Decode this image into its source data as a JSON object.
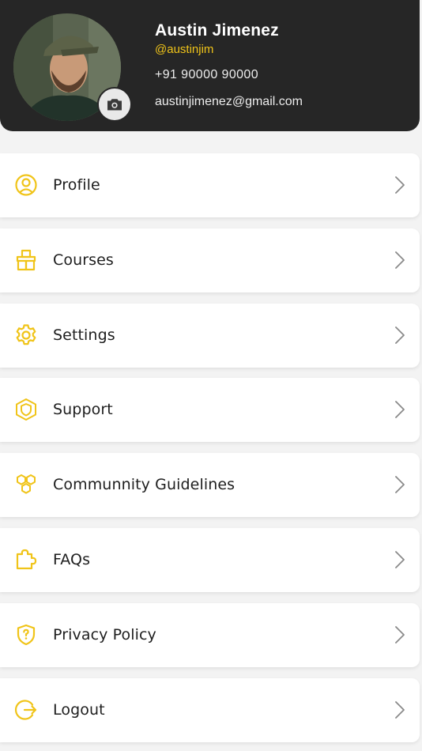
{
  "colors": {
    "accent": "#f0c419",
    "header_bg": "#262626",
    "page_bg": "#f3f3f3"
  },
  "profile": {
    "name": "Austin Jimenez",
    "handle": "@austinjim",
    "phone": "+91  90000 90000",
    "email": "austinjimenez@gmail.com"
  },
  "menu": [
    {
      "label": "Profile",
      "icon": "user-circle-icon"
    },
    {
      "label": "Courses",
      "icon": "courses-icon"
    },
    {
      "label": "Settings",
      "icon": "gear-icon"
    },
    {
      "label": "Support",
      "icon": "support-shield-icon"
    },
    {
      "label": "Communnity Guidelines",
      "icon": "hexagons-icon"
    },
    {
      "label": "FAQs",
      "icon": "puzzle-icon"
    },
    {
      "label": "Privacy Policy",
      "icon": "shield-question-icon"
    },
    {
      "label": "Logout",
      "icon": "logout-icon"
    }
  ]
}
